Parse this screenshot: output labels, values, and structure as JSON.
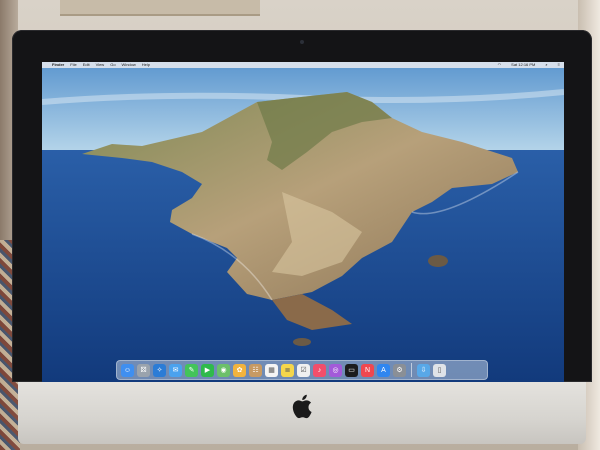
{
  "menubar": {
    "apple": "",
    "app_name": "Finder",
    "items": [
      "File",
      "Edit",
      "View",
      "Go",
      "Window",
      "Help"
    ],
    "clock": "Sat 12:16 PM"
  },
  "dock": {
    "apps": [
      {
        "name": "finder-icon",
        "color": "#3f8ff0"
      },
      {
        "name": "launchpad-icon",
        "color": "#9aa3ad"
      },
      {
        "name": "safari-icon",
        "color": "#2b7cd6"
      },
      {
        "name": "mail-icon",
        "color": "#4aa2ee"
      },
      {
        "name": "messages-icon",
        "color": "#43c45a"
      },
      {
        "name": "facetime-icon",
        "color": "#2fba4b"
      },
      {
        "name": "maps-icon",
        "color": "#6cc06a"
      },
      {
        "name": "photos-icon",
        "color": "#f2b33d"
      },
      {
        "name": "contacts-icon",
        "color": "#c79a63"
      },
      {
        "name": "calendar-icon",
        "color": "#f4f4f4"
      },
      {
        "name": "notes-icon",
        "color": "#f5d64b"
      },
      {
        "name": "reminders-icon",
        "color": "#f0f0f0"
      },
      {
        "name": "music-icon",
        "color": "#f24e6b"
      },
      {
        "name": "podcasts-icon",
        "color": "#a35ad9"
      },
      {
        "name": "tv-icon",
        "color": "#1c1c1e"
      },
      {
        "name": "news-icon",
        "color": "#f0474f"
      },
      {
        "name": "app-store-icon",
        "color": "#2f86f0"
      },
      {
        "name": "system-preferences-icon",
        "color": "#8a8f96"
      }
    ],
    "trailing": [
      {
        "name": "downloads-folder-icon",
        "color": "#58a8e8"
      },
      {
        "name": "trash-icon",
        "color": "#dfe3e8"
      }
    ]
  },
  "colors": {
    "sky": "#8bb8de",
    "sea": "#1b4a93",
    "bezel": "#141416",
    "chin": "#dcdad6"
  }
}
